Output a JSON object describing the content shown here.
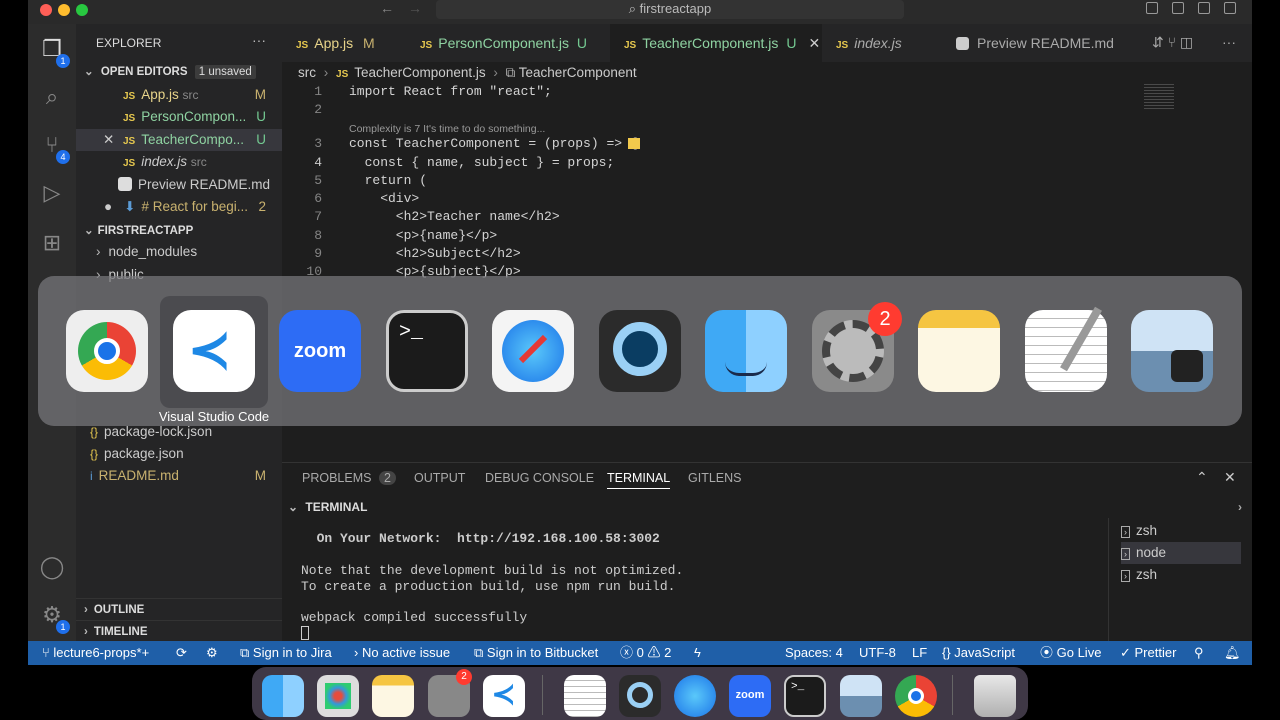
{
  "window": {
    "search_text": "firstreactapp"
  },
  "activity_bar": {
    "explorer_badge": "1",
    "scm_badge": "4",
    "settings_badge": "1"
  },
  "sidebar": {
    "title": "EXPLORER",
    "open_editors_label": "OPEN EDITORS",
    "unsaved_badge": "1 unsaved",
    "open_editors": [
      {
        "name": "App.js",
        "dir": "src",
        "status": "M",
        "icon": "js-icon"
      },
      {
        "name": "PersonCompon...",
        "dir": "",
        "status": "U",
        "icon": "js-icon"
      },
      {
        "name": "TeacherCompo...",
        "dir": "",
        "status": "U",
        "icon": "js-icon"
      },
      {
        "name": "index.js",
        "dir": "src",
        "status": "",
        "icon": "js-icon"
      },
      {
        "name": "Preview README.md",
        "dir": "",
        "status": "",
        "icon": "preview-icon"
      },
      {
        "name": "# React for begi...",
        "dir": "",
        "status": "2",
        "icon": "markdown-icon"
      }
    ],
    "project_label": "FIRSTREACTAPP",
    "files": [
      {
        "name": "node_modules"
      },
      {
        "name": "public"
      },
      {
        "name": "package-lock.json",
        "icon": "{}"
      },
      {
        "name": "package.json",
        "icon": "{}"
      },
      {
        "name": "README.md",
        "icon": "i",
        "status": "M"
      }
    ],
    "outline_label": "OUTLINE",
    "timeline_label": "TIMELINE"
  },
  "tabs": [
    {
      "label": "App.js",
      "status": "M"
    },
    {
      "label": "PersonComponent.js",
      "status": "U"
    },
    {
      "label": "TeacherComponent.js",
      "status": "U"
    },
    {
      "label": "index.js",
      "status": ""
    },
    {
      "label": "Preview README.md",
      "status": ""
    }
  ],
  "breadcrumb": {
    "folder": "src",
    "file": "TeacherComponent.js",
    "symbol": "TeacherComponent"
  },
  "editor": {
    "codelens": "Complexity is 7 It's time to do something...",
    "lines": [
      {
        "n": "1",
        "text": "import React from \"react\";"
      },
      {
        "n": "2",
        "text": ""
      },
      {
        "n": "3",
        "text": "const TeacherComponent = (props) => {"
      },
      {
        "n": "4",
        "text": "  const { name, subject } = props;"
      },
      {
        "n": "5",
        "text": "  return ("
      },
      {
        "n": "6",
        "text": "    <div>"
      },
      {
        "n": "7",
        "text": "      <h2>Teacher name</h2>"
      },
      {
        "n": "8",
        "text": "      <p>{name}</p>"
      },
      {
        "n": "9",
        "text": "      <h2>Subject</h2>"
      },
      {
        "n": "10",
        "text": "      <p>{subject}</p>"
      }
    ]
  },
  "panel": {
    "tabs": [
      "PROBLEMS",
      "OUTPUT",
      "DEBUG CONSOLE",
      "TERMINAL",
      "GITLENS"
    ],
    "problems_count": "2",
    "section": "TERMINAL",
    "terminal_lines": [
      "  On Your Network:  http://192.168.100.58:3002",
      "",
      "Note that the development build is not optimized.",
      "To create a production build, use npm run build.",
      "",
      "webpack compiled successfully"
    ],
    "terminals": [
      "zsh",
      "node",
      "zsh"
    ]
  },
  "statusbar": {
    "branch": "lecture6-props*+",
    "jira": "Sign in to Jira",
    "issue": "No active issue",
    "bitbucket": "Sign in to Bitbucket",
    "errors": "0",
    "warnings": "2",
    "spaces": "Spaces: 4",
    "encoding": "UTF-8",
    "eol": "LF",
    "language": "JavaScript",
    "golive": "Go Live",
    "prettier": "Prettier"
  },
  "switcher": {
    "selected_label": "Visual Studio Code",
    "settings_badge": "2",
    "zoom_text": "zoom"
  },
  "dock": {
    "settings_badge": "2",
    "zoom_text": "zoom"
  }
}
